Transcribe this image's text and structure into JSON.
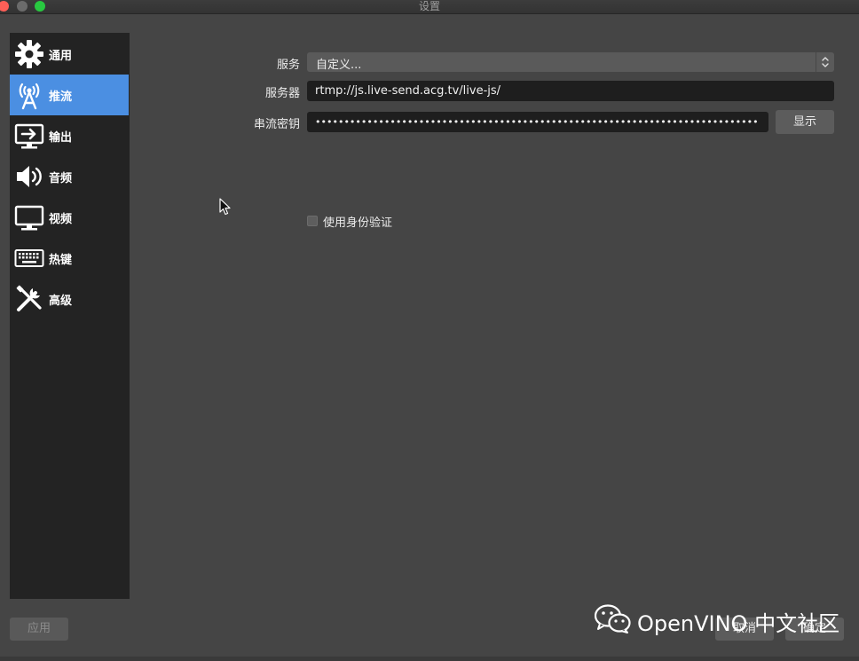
{
  "window": {
    "title": "设置"
  },
  "sidebar": {
    "items": [
      {
        "label": "通用",
        "icon": "gear-icon"
      },
      {
        "label": "推流",
        "icon": "broadcast-antenna-icon",
        "active": true
      },
      {
        "label": "输出",
        "icon": "output-monitor-icon"
      },
      {
        "label": "音频",
        "icon": "speaker-icon"
      },
      {
        "label": "视频",
        "icon": "monitor-icon"
      },
      {
        "label": "热键",
        "icon": "keyboard-icon"
      },
      {
        "label": "高级",
        "icon": "tools-icon"
      }
    ]
  },
  "stream": {
    "service_label": "服务",
    "service_value": "自定义...",
    "server_label": "服务器",
    "server_value": "rtmp://js.live-send.acg.tv/live-js/",
    "key_label": "串流密钥",
    "key_value": "•••••••••••••••••••••••••••••••••••••••••••••••••••••••••••••••••••••••••••••",
    "show_button": "显示",
    "auth_label": "使用身份验证",
    "auth_checked": false
  },
  "footer": {
    "apply_button": "应用",
    "cancel_button": "取消",
    "ok_button": "确定"
  },
  "watermark": {
    "text": "OpenVINO 中文社区",
    "icon": "wechat-icon"
  },
  "colors": {
    "accent": "#4b8fe2",
    "panel": "#454545",
    "sidebar": "#232323"
  }
}
